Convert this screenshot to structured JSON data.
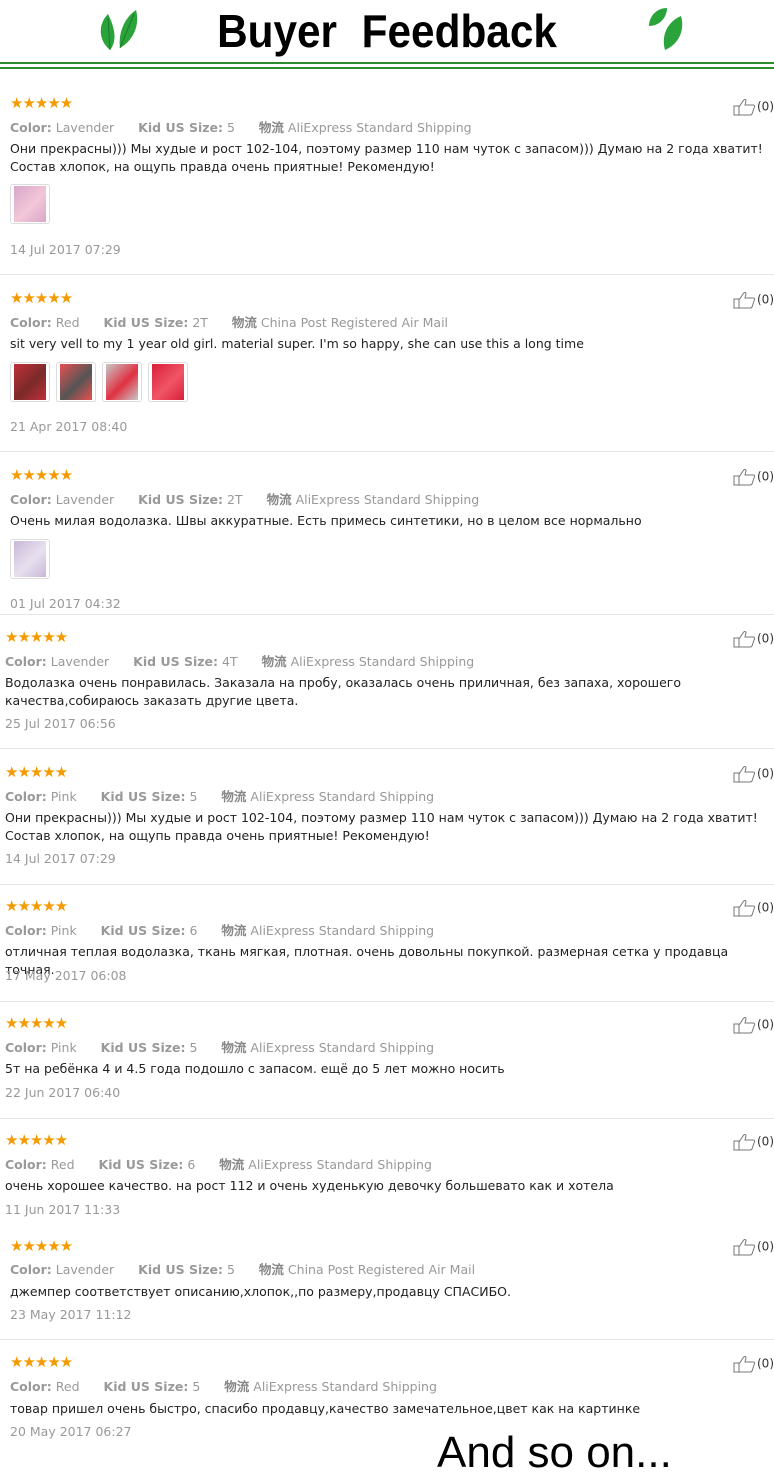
{
  "header": {
    "title": "Buyer   Feedback"
  },
  "labels": {
    "color": "Color:",
    "size": "Kid US Size:",
    "shipping_prefix": "物流"
  },
  "reviews": [
    {
      "stars": "★★★★★",
      "color": "Lavender",
      "size": "5",
      "shipping": "AliExpress Standard Shipping",
      "text": "Они прекрасны))) Мы худые и рост 102-104, поэтому размер 110 нам чуток с запасом))) Думаю на 2 года хватит! Состав хлопок, на ощупь правда очень приятные! Рекомендую!",
      "date": "14 Jul 2017 07:29",
      "helpful": "(0)"
    },
    {
      "stars": "★★★★★",
      "color": "Red",
      "size": "2T",
      "shipping": "China Post Registered Air Mail",
      "text": "sit very vell to my 1 year old girl. material super. I'm so happy, she can use this a long time",
      "date": "21 Apr 2017 08:40",
      "helpful": "(0)"
    },
    {
      "stars": "★★★★★",
      "color": "Lavender",
      "size": "2T",
      "shipping": "AliExpress Standard Shipping",
      "text": "Очень милая водолазка. Швы аккуратные. Есть примесь синтетики, но в целом все нормально",
      "date": "01 Jul 2017 04:32",
      "helpful": "(0)"
    },
    {
      "stars": "★★★★★",
      "color": "Lavender",
      "size": "4T",
      "shipping": "AliExpress Standard Shipping",
      "text": "Водолазка очень понравилась. Заказала на пробу, оказалась очень приличная, без запаха, хорошего качества,собираюсь заказать другие цвета.",
      "date": "25 Jul 2017 06:56",
      "helpful": "(0)"
    },
    {
      "stars": "★★★★★",
      "color": "Pink",
      "size": "5",
      "shipping": "AliExpress Standard Shipping",
      "text": "Они прекрасны))) Мы худые и рост 102-104, поэтому размер 110 нам чуток с запасом))) Думаю на 2 года хватит! Состав хлопок, на ощупь правда очень приятные! Рекомендую!",
      "date": "14 Jul 2017 07:29",
      "helpful": "(0)"
    },
    {
      "stars": "★★★★★",
      "color": "Pink",
      "size": "6",
      "shipping": "AliExpress Standard Shipping",
      "text": "отличная теплая водолазка, ткань мягкая, плотная. очень довольны покупкой. размерная сетка у продавца точная.",
      "date": "17 May 2017 06:08",
      "helpful": "(0)"
    },
    {
      "stars": "★★★★★",
      "color": "Pink",
      "size": "5",
      "shipping": "AliExpress Standard Shipping",
      "text": "5т на ребёнка 4 и 4.5 года подошло с запасом. ещё до 5 лет можно носить",
      "date": "22 Jun 2017 06:40",
      "helpful": "(0)"
    },
    {
      "stars": "★★★★★",
      "color": "Red",
      "size": "6",
      "shipping": "AliExpress Standard Shipping",
      "text": "очень хорошее качество. на рост 112 и очень худенькую девочку большевато как и хотела",
      "date": "11 Jun 2017 11:33",
      "helpful": "(0)"
    },
    {
      "stars": "★★★★★",
      "color": "Lavender",
      "size": "5",
      "shipping": "China Post Registered Air Mail",
      "text": "джемпер соответствует описанию,хлопок,,по размеру,продавцу СПАСИБО.",
      "date": "23 May 2017 11:12",
      "helpful": "(0)"
    },
    {
      "stars": "★★★★★",
      "color": "Red",
      "size": "5",
      "shipping": "AliExpress Standard Shipping",
      "text": "товар пришел очень быстро, спасибо продавцу,качество замечательное,цвет как на картинке",
      "date": "20 May 2017 06:27",
      "helpful": "(0)"
    }
  ],
  "footer": {
    "and_so_on": "And so on..."
  },
  "colors": {
    "stars": "#f59a00",
    "header_line": "#2e8b2e",
    "leaf": "#2aa33a"
  }
}
